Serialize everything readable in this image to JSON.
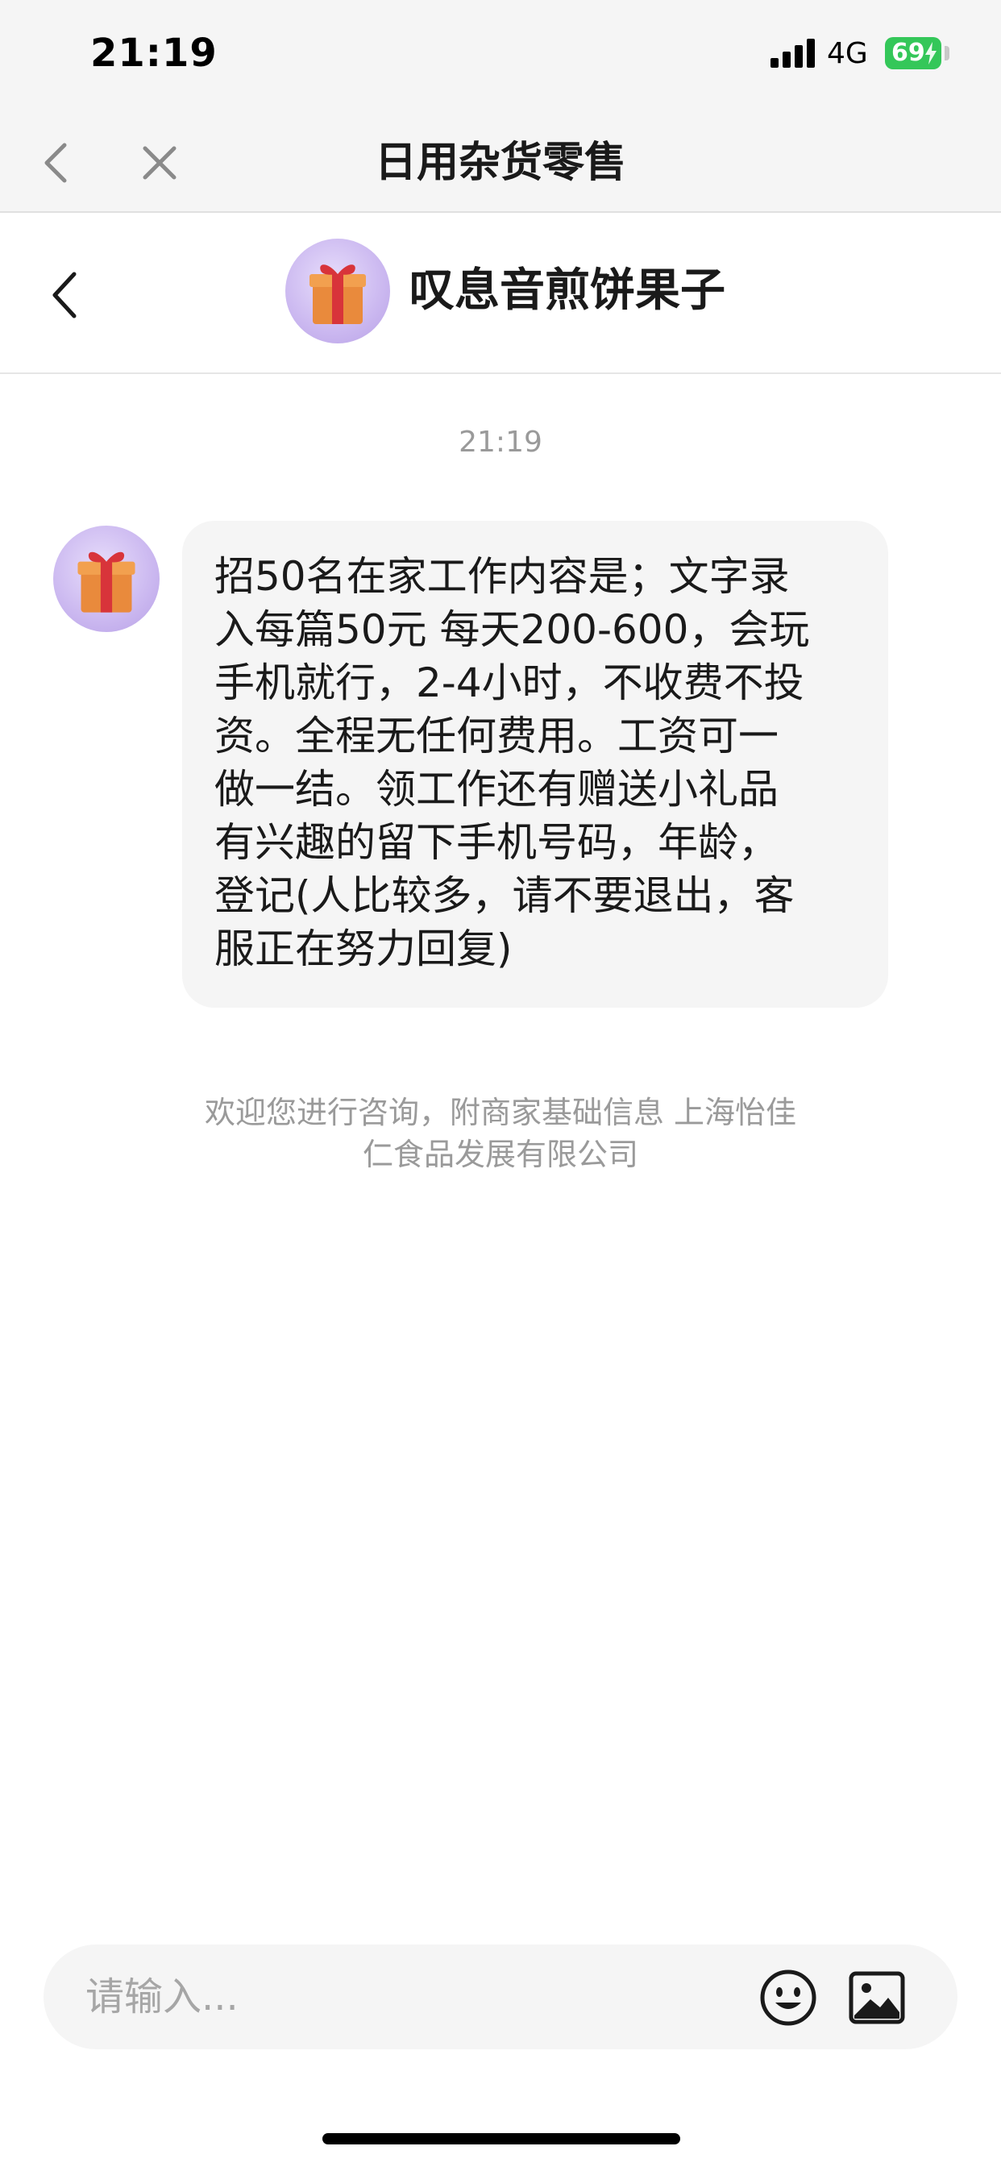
{
  "status_bar": {
    "time": "21:19",
    "network": "4G",
    "battery": "69",
    "battery_color": "#34c759"
  },
  "nav": {
    "title": "日用杂货零售",
    "back_icon": "chevron-left-icon",
    "close_icon": "close-icon"
  },
  "chat_header": {
    "name": "叹息音煎饼果子",
    "avatar_icon": "gift-box-icon",
    "back_icon": "chevron-left-icon"
  },
  "messages": {
    "timestamp": "21:19",
    "incoming_text": "招50名在家工作内容是；文字录\n入每篇50元 每天200-600，会玩\n手机就行，2-4小时，不收费不投\n资。全程无任何费用。工资可一\n做一结。领工作还有赠送小礼品\n有兴趣的留下手机号码，年龄，\n登记(人比较多，请不要退出，客\n服正在努力回复)",
    "merchant_info_line1": "欢迎您进行咨询，附商家基础信息 上海怡佳",
    "merchant_info_line2": "仁食品发展有限公司"
  },
  "input": {
    "placeholder": "请输入...",
    "value": "",
    "emoji_icon": "emoji-smile-icon",
    "image_icon": "image-icon"
  }
}
